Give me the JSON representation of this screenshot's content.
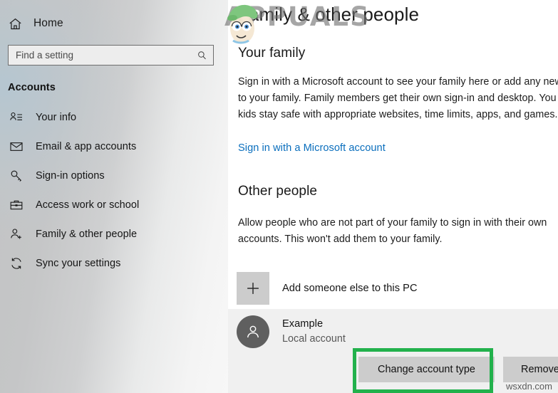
{
  "sidebar": {
    "home": {
      "label": "Home",
      "icon": "home-icon"
    },
    "search": {
      "value": "",
      "placeholder": "Find a setting",
      "icon": "search-icon"
    },
    "section_title": "Accounts",
    "items": [
      {
        "label": "Your info",
        "icon": "person-list-icon"
      },
      {
        "label": "Email & app accounts",
        "icon": "envelope-icon"
      },
      {
        "label": "Sign-in options",
        "icon": "key-icon"
      },
      {
        "label": "Access work or school",
        "icon": "briefcase-icon"
      },
      {
        "label": "Family & other people",
        "icon": "person-add-icon"
      },
      {
        "label": "Sync your settings",
        "icon": "sync-icon"
      }
    ]
  },
  "main": {
    "page_title": "Family & other people",
    "family": {
      "heading": "Your family",
      "description": "Sign in with a Microsoft account to see your family here or add any new members to your family. Family members get their own sign-in and desktop. You can help kids stay safe with appropriate websites, time limits, apps, and games.",
      "link": "Sign in with a Microsoft account"
    },
    "other_people": {
      "heading": "Other people",
      "description": "Allow people who are not part of your family to sign in with their own accounts. This won't add them to your family.",
      "add_label": "Add someone else to this PC",
      "add_icon": "plus-icon",
      "account": {
        "avatar_icon": "person-icon",
        "name": "Example",
        "type": "Local account",
        "change_button": "Change account type",
        "remove_button": "Remove"
      }
    }
  },
  "annotation": {
    "highlight_color": "#22b14c",
    "highlight_target": "Change account type"
  },
  "watermarks": {
    "brand": "APPUALS",
    "site": "wsxdn.com"
  },
  "colors": {
    "accent_link": "#0a6ebd",
    "button_face": "#cccccc",
    "selected_row": "#f0f0f0"
  }
}
